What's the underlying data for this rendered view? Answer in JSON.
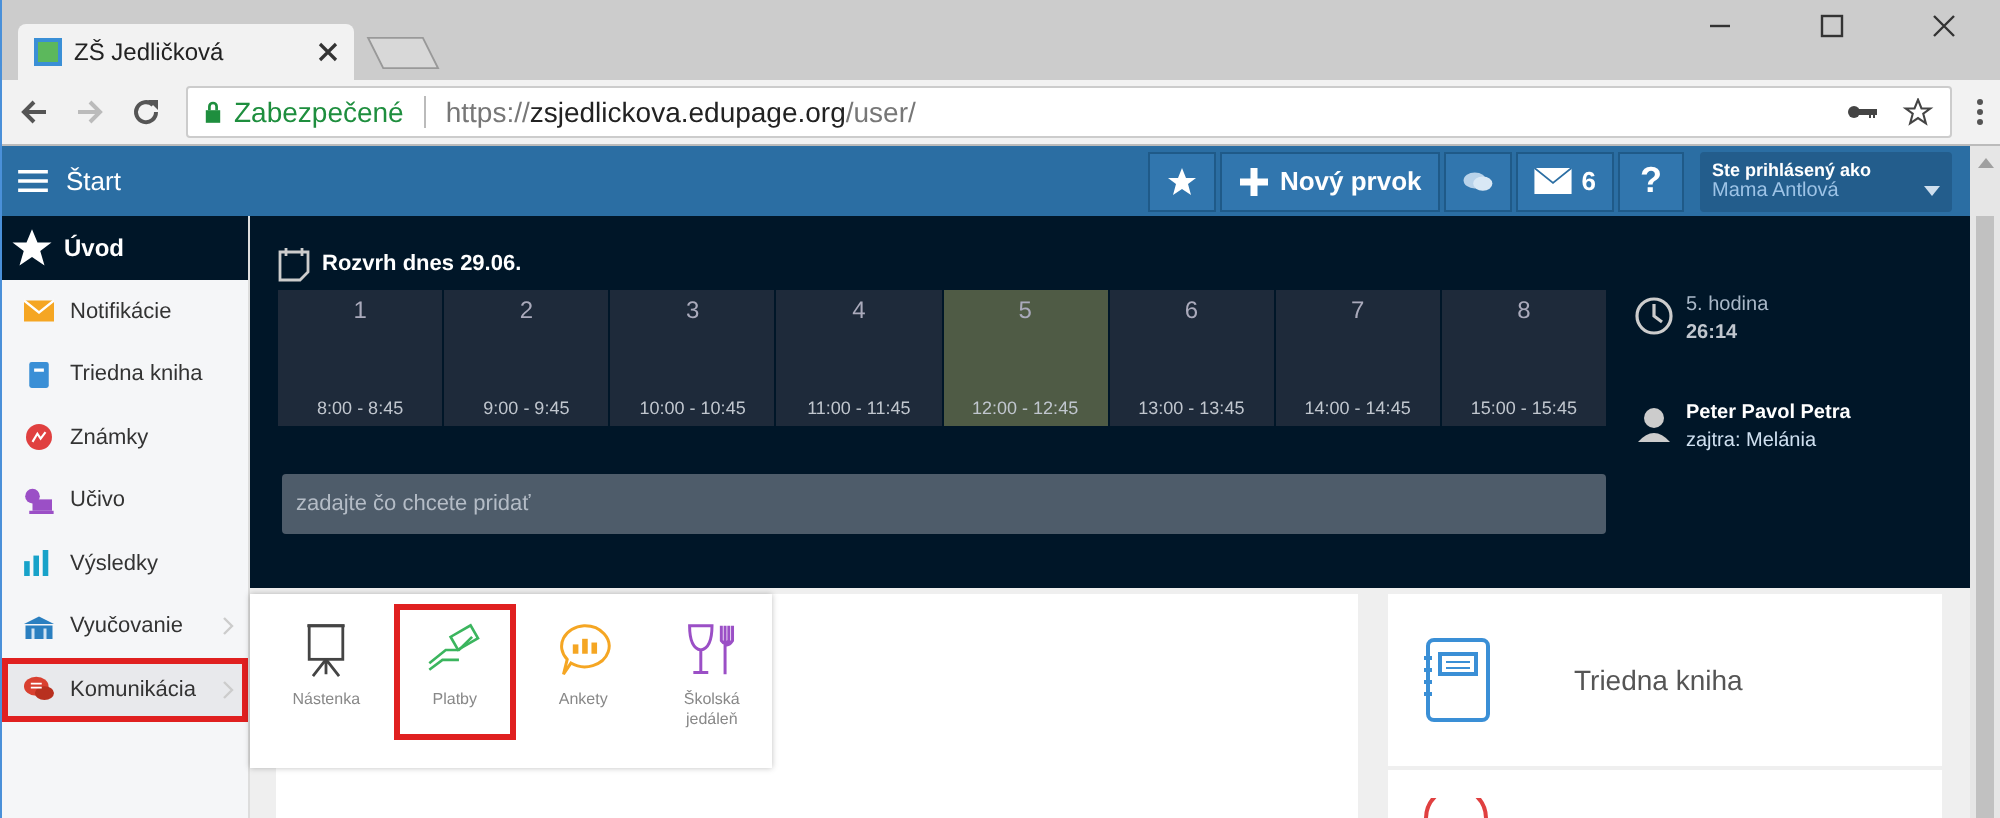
{
  "browser": {
    "tab_title": "ZŠ Jedličková",
    "security_label": "Zabezpečené",
    "url_scheme": "https://",
    "url_host": "zsjedlickova.edupage.org",
    "url_path": "/user/"
  },
  "header": {
    "title": "Štart",
    "new_item_label": "Nový prvok",
    "messages_count": "6",
    "help_label": "?",
    "user_caption": "Ste prihlásený ako",
    "user_name": "Mama Antlová"
  },
  "sidebar": {
    "home_label": "Úvod",
    "items": [
      {
        "label": "Notifikácie",
        "kind": "mail",
        "has_submenu": false,
        "highlighted": false
      },
      {
        "label": "Triedna kniha",
        "kind": "book",
        "has_submenu": false,
        "highlighted": false
      },
      {
        "label": "Známky",
        "kind": "grades",
        "has_submenu": false,
        "highlighted": false
      },
      {
        "label": "Učivo",
        "kind": "lesson",
        "has_submenu": false,
        "highlighted": false
      },
      {
        "label": "Výsledky",
        "kind": "chart",
        "has_submenu": false,
        "highlighted": false
      },
      {
        "label": "Vyučovanie",
        "kind": "school",
        "has_submenu": true,
        "highlighted": false
      },
      {
        "label": "Komunikácia",
        "kind": "chat",
        "has_submenu": true,
        "highlighted": true
      }
    ]
  },
  "submenu": [
    {
      "label": "Nástenka",
      "kind": "board",
      "highlighted": false
    },
    {
      "label": "Platby",
      "kind": "money",
      "highlighted": true
    },
    {
      "label": "Ankety",
      "kind": "poll",
      "highlighted": false
    },
    {
      "label": "Školská jedáleň",
      "kind": "food",
      "highlighted": false
    }
  ],
  "timetable": {
    "title": "Rozvrh dnes 29.06.",
    "periods": [
      {
        "number": "1",
        "time": "8:00 - 8:45",
        "selected": false
      },
      {
        "number": "2",
        "time": "9:00 - 9:45",
        "selected": false
      },
      {
        "number": "3",
        "time": "10:00 - 10:45",
        "selected": false
      },
      {
        "number": "4",
        "time": "11:00 - 11:45",
        "selected": false
      },
      {
        "number": "5",
        "time": "12:00 - 12:45",
        "selected": true
      },
      {
        "number": "6",
        "time": "13:00 - 13:45",
        "selected": false
      },
      {
        "number": "7",
        "time": "14:00 - 14:45",
        "selected": false
      },
      {
        "number": "8",
        "time": "15:00 - 15:45",
        "selected": false
      }
    ]
  },
  "add_field": {
    "placeholder": "zadajte čo chcete pridať"
  },
  "current": {
    "period": "5. hodina",
    "countdown": "26:14",
    "name": "Peter Pavol Petra",
    "tomorrow": "zajtra: Melánia"
  },
  "cards": [
    {
      "label": "Triedna kniha"
    }
  ]
}
